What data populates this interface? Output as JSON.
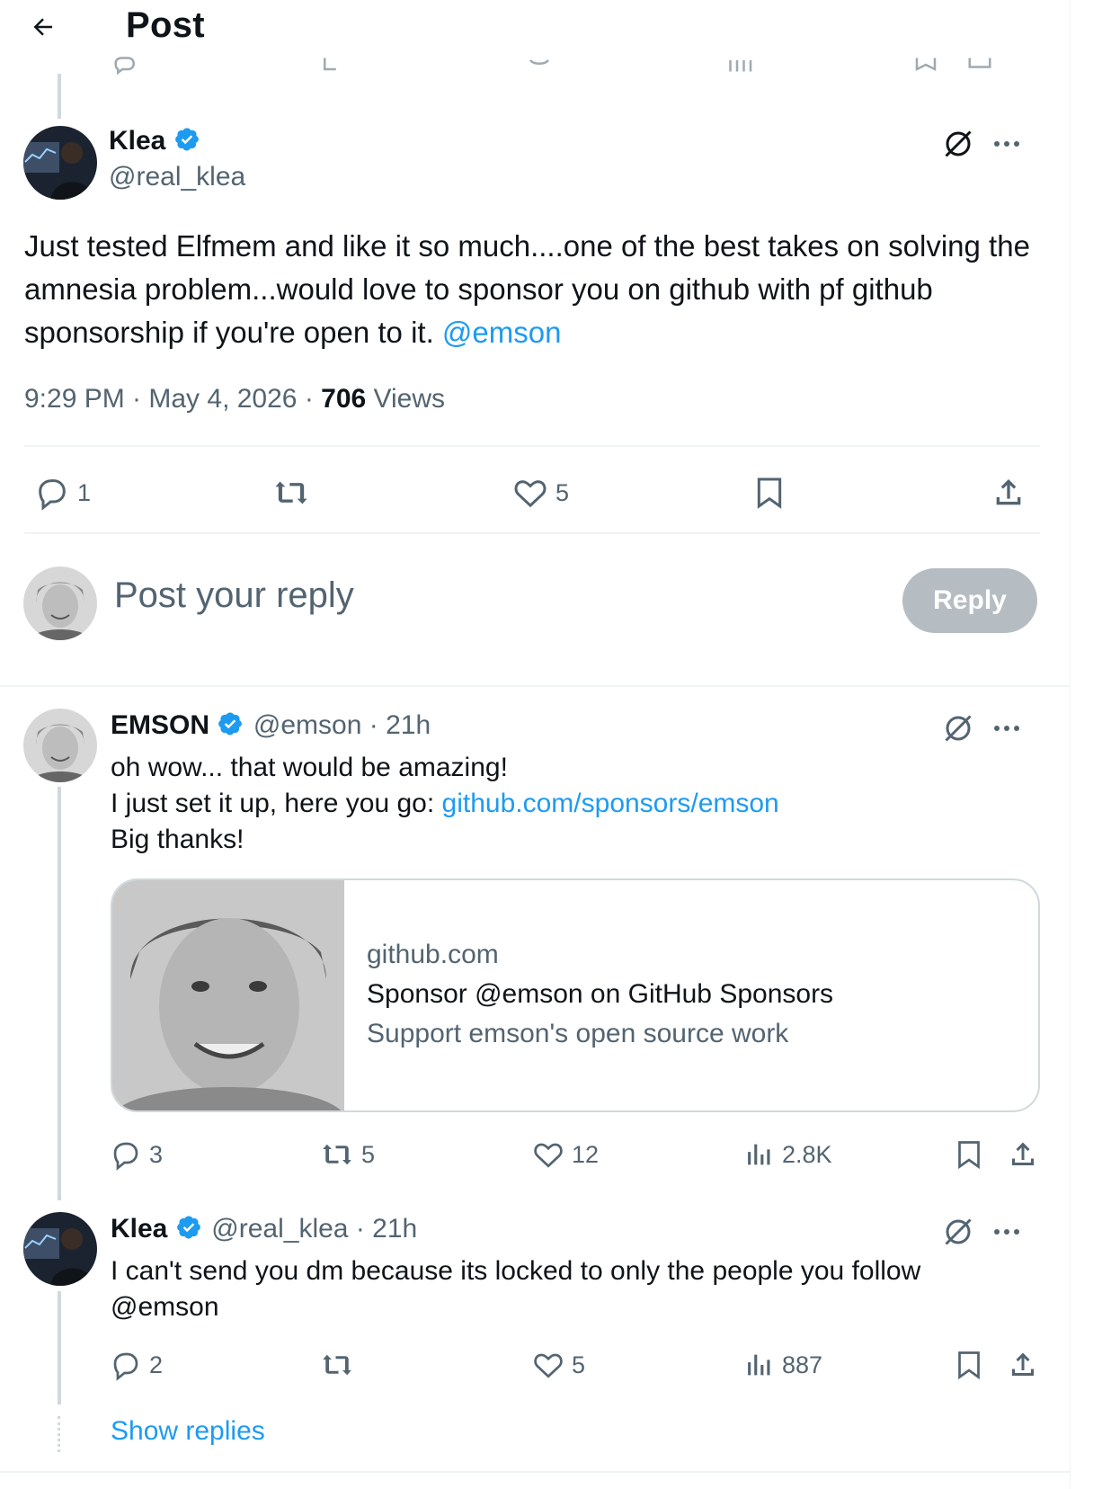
{
  "header": {
    "title": "Post"
  },
  "main_tweet": {
    "name": "Klea",
    "handle": "@real_klea",
    "text": "Just tested Elfmem and like it so much....one of the best takes on solving the amnesia problem...would love to sponsor you on  github with pf github sponsorship if you're open to it.",
    "mention": "@emson",
    "time": "9:29 PM · May 4, 2026 · ",
    "views_count": "706",
    "views_label": " Views",
    "replies": "1",
    "likes": "5"
  },
  "composer": {
    "placeholder": "Post your reply",
    "button": "Reply"
  },
  "reply1": {
    "name": "EMSON",
    "handle": "@emson · 21h",
    "line1": "oh wow... that would be amazing!",
    "line2_prefix": "I just set it up, here you go: ",
    "line2_link": "github.com/sponsors/emson",
    "line3": "Big thanks!",
    "card": {
      "domain": "github.com",
      "title": "Sponsor @emson on GitHub Sponsors",
      "description": "Support emson's open source work"
    },
    "replies": "3",
    "reposts": "5",
    "likes": "12",
    "views": "2.8K"
  },
  "reply2": {
    "name": "Klea",
    "handle": "@real_klea · 21h",
    "line1": "I can't send you dm because its locked to only the people you follow",
    "mention": "@emson",
    "replies": "2",
    "likes": "5",
    "views": "887"
  },
  "show_replies": "Show replies",
  "colors": {
    "accent": "#1d9bf0",
    "muted": "#536471",
    "text": "#0f1419",
    "border": "#eff3f4"
  }
}
